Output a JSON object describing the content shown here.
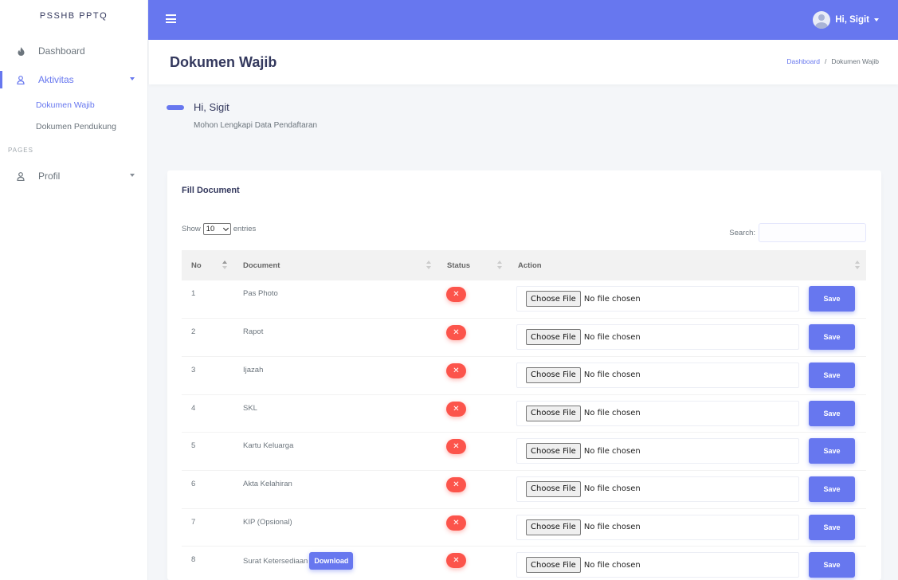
{
  "sidebar": {
    "brand": "PSSHB PPTQ",
    "items": [
      {
        "label": "Dashboard",
        "icon": "fire-icon"
      },
      {
        "label": "Aktivitas",
        "icon": "user-icon"
      }
    ],
    "submenu": [
      "Dokumen Wajib",
      "Dokumen Pendukung"
    ],
    "pages_header": "PAGES",
    "profile_label": "Profil"
  },
  "topbar": {
    "user_name": "Hi, Sigit"
  },
  "header": {
    "title": "Dokumen Wajib",
    "breadcrumb": [
      "Dashboard",
      "Dokumen Wajib"
    ]
  },
  "greeting": {
    "title": "Hi, Sigit",
    "subtitle": "Mohon Lengkapi Data Pendaftaran"
  },
  "card": {
    "title": "Fill Document",
    "show_label": "Show",
    "entries_value": "10",
    "entries_label": "entries",
    "search_label": "Search:"
  },
  "table": {
    "columns": [
      "No",
      "Document",
      "Status",
      "Action"
    ],
    "choose_label": "Choose File",
    "no_file_label": "No file chosen",
    "save_label": "Save",
    "download_label": "Download",
    "rows": [
      {
        "no": "1",
        "document": "Pas Photo"
      },
      {
        "no": "2",
        "document": "Rapot"
      },
      {
        "no": "3",
        "document": "Ijazah"
      },
      {
        "no": "4",
        "document": "SKL"
      },
      {
        "no": "5",
        "document": "Kartu Keluarga"
      },
      {
        "no": "6",
        "document": "Akta Kelahiran"
      },
      {
        "no": "7",
        "document": "KIP (Opsional)"
      },
      {
        "no": "8",
        "document": "Surat Ketersediaan"
      }
    ]
  },
  "colors": {
    "primary": "#6777ef",
    "danger": "#fc544b"
  }
}
